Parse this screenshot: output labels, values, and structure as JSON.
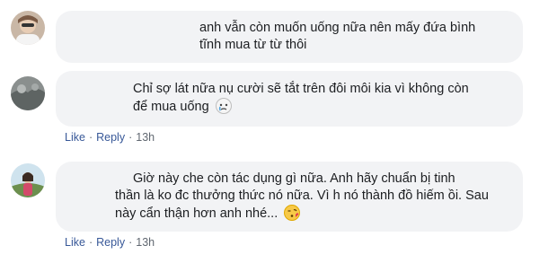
{
  "comments": [
    {
      "lines": [
        "anh vẫn còn muốn uống nữa nên mấy đứa bình",
        "tĩnh mua từ từ thôi"
      ],
      "emoji": "",
      "actions": null
    },
    {
      "lines": [
        "Chỉ sợ lát nữa nụ cười sẽ tắt trên đôi môi kia vì không còn",
        "để mua uống"
      ],
      "emoji": "crying-face",
      "actions": {
        "like": "Like",
        "reply": "Reply",
        "time": "13h",
        "dot": "·"
      }
    },
    {
      "lines": [
        "Giờ này che còn tác dụng gì nữa. Anh hãy chuẩn bị tinh",
        "thần là ko đc thưởng thức nó nữa. Vì h nó thành đồ hiếm ồi. Sau",
        "này cẩn thận hơn anh nhé..."
      ],
      "emoji": "kissing-face",
      "actions": {
        "like": "Like",
        "reply": "Reply",
        "time": "13h",
        "dot": "·"
      }
    }
  ],
  "colors": {
    "bubble": "#f2f3f5",
    "link": "#385898",
    "meta": "#606770"
  }
}
